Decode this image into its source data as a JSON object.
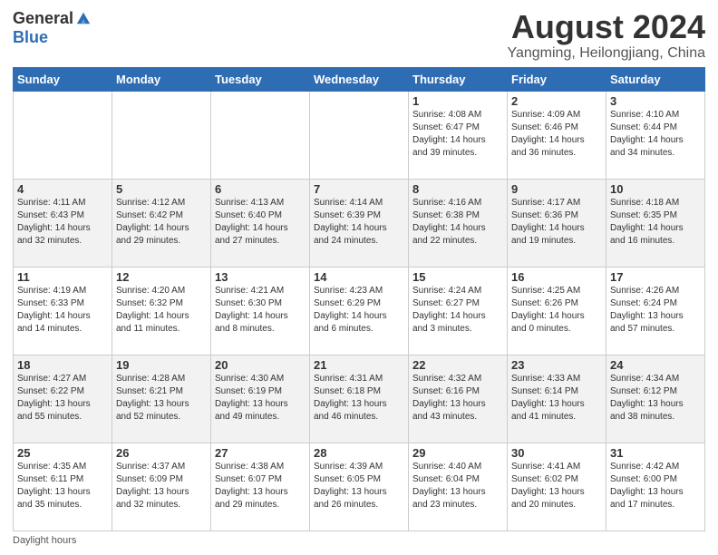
{
  "logo": {
    "general": "General",
    "blue": "Blue"
  },
  "title": "August 2024",
  "subtitle": "Yangming, Heilongjiang, China",
  "days_header": [
    "Sunday",
    "Monday",
    "Tuesday",
    "Wednesday",
    "Thursday",
    "Friday",
    "Saturday"
  ],
  "weeks": [
    [
      {
        "day": "",
        "info": ""
      },
      {
        "day": "",
        "info": ""
      },
      {
        "day": "",
        "info": ""
      },
      {
        "day": "",
        "info": ""
      },
      {
        "day": "1",
        "info": "Sunrise: 4:08 AM\nSunset: 6:47 PM\nDaylight: 14 hours and 39 minutes."
      },
      {
        "day": "2",
        "info": "Sunrise: 4:09 AM\nSunset: 6:46 PM\nDaylight: 14 hours and 36 minutes."
      },
      {
        "day": "3",
        "info": "Sunrise: 4:10 AM\nSunset: 6:44 PM\nDaylight: 14 hours and 34 minutes."
      }
    ],
    [
      {
        "day": "4",
        "info": "Sunrise: 4:11 AM\nSunset: 6:43 PM\nDaylight: 14 hours and 32 minutes."
      },
      {
        "day": "5",
        "info": "Sunrise: 4:12 AM\nSunset: 6:42 PM\nDaylight: 14 hours and 29 minutes."
      },
      {
        "day": "6",
        "info": "Sunrise: 4:13 AM\nSunset: 6:40 PM\nDaylight: 14 hours and 27 minutes."
      },
      {
        "day": "7",
        "info": "Sunrise: 4:14 AM\nSunset: 6:39 PM\nDaylight: 14 hours and 24 minutes."
      },
      {
        "day": "8",
        "info": "Sunrise: 4:16 AM\nSunset: 6:38 PM\nDaylight: 14 hours and 22 minutes."
      },
      {
        "day": "9",
        "info": "Sunrise: 4:17 AM\nSunset: 6:36 PM\nDaylight: 14 hours and 19 minutes."
      },
      {
        "day": "10",
        "info": "Sunrise: 4:18 AM\nSunset: 6:35 PM\nDaylight: 14 hours and 16 minutes."
      }
    ],
    [
      {
        "day": "11",
        "info": "Sunrise: 4:19 AM\nSunset: 6:33 PM\nDaylight: 14 hours and 14 minutes."
      },
      {
        "day": "12",
        "info": "Sunrise: 4:20 AM\nSunset: 6:32 PM\nDaylight: 14 hours and 11 minutes."
      },
      {
        "day": "13",
        "info": "Sunrise: 4:21 AM\nSunset: 6:30 PM\nDaylight: 14 hours and 8 minutes."
      },
      {
        "day": "14",
        "info": "Sunrise: 4:23 AM\nSunset: 6:29 PM\nDaylight: 14 hours and 6 minutes."
      },
      {
        "day": "15",
        "info": "Sunrise: 4:24 AM\nSunset: 6:27 PM\nDaylight: 14 hours and 3 minutes."
      },
      {
        "day": "16",
        "info": "Sunrise: 4:25 AM\nSunset: 6:26 PM\nDaylight: 14 hours and 0 minutes."
      },
      {
        "day": "17",
        "info": "Sunrise: 4:26 AM\nSunset: 6:24 PM\nDaylight: 13 hours and 57 minutes."
      }
    ],
    [
      {
        "day": "18",
        "info": "Sunrise: 4:27 AM\nSunset: 6:22 PM\nDaylight: 13 hours and 55 minutes."
      },
      {
        "day": "19",
        "info": "Sunrise: 4:28 AM\nSunset: 6:21 PM\nDaylight: 13 hours and 52 minutes."
      },
      {
        "day": "20",
        "info": "Sunrise: 4:30 AM\nSunset: 6:19 PM\nDaylight: 13 hours and 49 minutes."
      },
      {
        "day": "21",
        "info": "Sunrise: 4:31 AM\nSunset: 6:18 PM\nDaylight: 13 hours and 46 minutes."
      },
      {
        "day": "22",
        "info": "Sunrise: 4:32 AM\nSunset: 6:16 PM\nDaylight: 13 hours and 43 minutes."
      },
      {
        "day": "23",
        "info": "Sunrise: 4:33 AM\nSunset: 6:14 PM\nDaylight: 13 hours and 41 minutes."
      },
      {
        "day": "24",
        "info": "Sunrise: 4:34 AM\nSunset: 6:12 PM\nDaylight: 13 hours and 38 minutes."
      }
    ],
    [
      {
        "day": "25",
        "info": "Sunrise: 4:35 AM\nSunset: 6:11 PM\nDaylight: 13 hours and 35 minutes."
      },
      {
        "day": "26",
        "info": "Sunrise: 4:37 AM\nSunset: 6:09 PM\nDaylight: 13 hours and 32 minutes."
      },
      {
        "day": "27",
        "info": "Sunrise: 4:38 AM\nSunset: 6:07 PM\nDaylight: 13 hours and 29 minutes."
      },
      {
        "day": "28",
        "info": "Sunrise: 4:39 AM\nSunset: 6:05 PM\nDaylight: 13 hours and 26 minutes."
      },
      {
        "day": "29",
        "info": "Sunrise: 4:40 AM\nSunset: 6:04 PM\nDaylight: 13 hours and 23 minutes."
      },
      {
        "day": "30",
        "info": "Sunrise: 4:41 AM\nSunset: 6:02 PM\nDaylight: 13 hours and 20 minutes."
      },
      {
        "day": "31",
        "info": "Sunrise: 4:42 AM\nSunset: 6:00 PM\nDaylight: 13 hours and 17 minutes."
      }
    ]
  ],
  "footer_label": "Daylight hours"
}
